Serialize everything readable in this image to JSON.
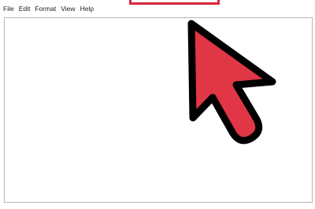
{
  "menu": {
    "items": [
      {
        "label": "File"
      },
      {
        "label": "Edit"
      },
      {
        "label": "Format"
      },
      {
        "label": "View"
      },
      {
        "label": "Help"
      }
    ]
  },
  "editor": {
    "content": ""
  },
  "annotation": {
    "highlight_color": "#d8283b",
    "cursor_icon": "mouse-pointer-arrow-icon",
    "cursor_fill": "#e03645",
    "cursor_outline": "#000000"
  }
}
